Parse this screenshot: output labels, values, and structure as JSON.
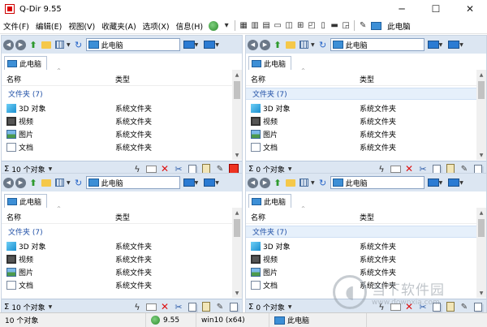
{
  "window": {
    "title": "Q-Dir 9.55",
    "controls": [
      "─",
      "☐",
      "✕"
    ]
  },
  "menu": {
    "items": [
      "文件(F)",
      "编辑(E)",
      "视图(V)",
      "收藏夹(A)",
      "选项(X)",
      "信息(H)"
    ],
    "right_label": "此电脑"
  },
  "panes": [
    {
      "path": "此电脑",
      "tab_label": "此电脑",
      "columns": [
        "名称",
        "类型"
      ],
      "group_label": "文件夹 (7)",
      "group_selected": false,
      "rows": [
        {
          "name": "3D 对象",
          "type": "系统文件夹",
          "icon": "3d-objects-icon"
        },
        {
          "name": "视频",
          "type": "系统文件夹",
          "icon": "video-icon"
        },
        {
          "name": "图片",
          "type": "系统文件夹",
          "icon": "pictures-icon"
        },
        {
          "name": "文档",
          "type": "系统文件夹",
          "icon": "documents-icon"
        }
      ],
      "status_count": "10 个对象"
    },
    {
      "path": "此电脑",
      "tab_label": "此电脑",
      "columns": [
        "名称",
        "类型"
      ],
      "group_label": "文件夹 (7)",
      "group_selected": true,
      "rows": [
        {
          "name": "3D 对象",
          "type": "系统文件夹",
          "icon": "3d-objects-icon"
        },
        {
          "name": "视频",
          "type": "系统文件夹",
          "icon": "video-icon"
        },
        {
          "name": "图片",
          "type": "系统文件夹",
          "icon": "pictures-icon"
        },
        {
          "name": "文档",
          "type": "系统文件夹",
          "icon": "documents-icon"
        }
      ],
      "status_count": "0 个对象"
    },
    {
      "path": "此电脑",
      "tab_label": "此电脑",
      "columns": [
        "名称",
        "类型"
      ],
      "group_label": "文件夹 (7)",
      "group_selected": false,
      "rows": [
        {
          "name": "3D 对象",
          "type": "系统文件夹",
          "icon": "3d-objects-icon"
        },
        {
          "name": "视频",
          "type": "系统文件夹",
          "icon": "video-icon"
        },
        {
          "name": "图片",
          "type": "系统文件夹",
          "icon": "pictures-icon"
        },
        {
          "name": "文档",
          "type": "系统文件夹",
          "icon": "documents-icon"
        }
      ],
      "status_count": "10 个对象"
    },
    {
      "path": "此电脑",
      "tab_label": "此电脑",
      "columns": [
        "名称",
        "类型"
      ],
      "group_label": "文件夹 (7)",
      "group_selected": true,
      "rows": [
        {
          "name": "3D 对象",
          "type": "系统文件夹",
          "icon": "3d-objects-icon"
        },
        {
          "name": "视频",
          "type": "系统文件夹",
          "icon": "video-icon"
        },
        {
          "name": "图片",
          "type": "系统文件夹",
          "icon": "pictures-icon"
        },
        {
          "name": "文档",
          "type": "系统文件夹",
          "icon": "documents-icon"
        }
      ],
      "status_count": "0 个对象"
    }
  ],
  "statusbar": {
    "left": "10 个对象",
    "version": "9.55",
    "os": "win10 (x64)",
    "location": "此电脑"
  },
  "watermark": {
    "title": "当下软件园",
    "url": "www.downxia.com"
  },
  "colors": {
    "pane_toolbar": "#dce6f2",
    "group_text": "#1f4fa6",
    "delete_red": "#dd1111"
  }
}
